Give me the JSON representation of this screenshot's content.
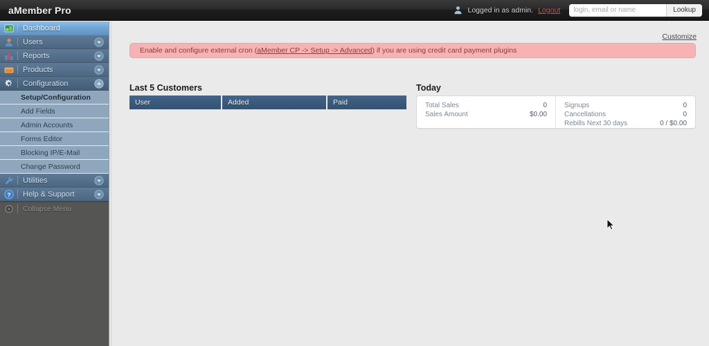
{
  "header": {
    "brand": "aMember Pro",
    "user_icon": "user-icon",
    "login_status": "Logged in as admin.",
    "logout_label": "Logout",
    "lookup_placeholder": "login, email or name",
    "lookup_value": "",
    "lookup_button": "Lookup"
  },
  "sidebar": {
    "items": [
      {
        "label": "Dashboard",
        "icon": "dashboard-icon",
        "state": "active",
        "chevron": "none"
      },
      {
        "label": "Users",
        "icon": "users-icon",
        "state": "normal",
        "chevron": "down"
      },
      {
        "label": "Reports",
        "icon": "reports-icon",
        "state": "normal",
        "chevron": "down"
      },
      {
        "label": "Products",
        "icon": "products-icon",
        "state": "normal",
        "chevron": "down"
      },
      {
        "label": "Configuration",
        "icon": "gear-icon",
        "state": "expanded",
        "chevron": "up"
      }
    ],
    "submenu": [
      {
        "label": "Setup/Configuration",
        "current": true
      },
      {
        "label": "Add Fields",
        "current": false
      },
      {
        "label": "Admin Accounts",
        "current": false
      },
      {
        "label": "Forms Editor",
        "current": false
      },
      {
        "label": "Blocking IP/E-Mail",
        "current": false
      },
      {
        "label": "Change Password",
        "current": false
      }
    ],
    "items_bottom": [
      {
        "label": "Utilities",
        "icon": "wrench-icon",
        "state": "normal",
        "chevron": "down"
      },
      {
        "label": "Help & Support",
        "icon": "help-icon",
        "state": "normal",
        "chevron": "down"
      }
    ],
    "collapse": {
      "label": "Collapse Menu",
      "icon": "collapse-icon"
    }
  },
  "content": {
    "customize_label": "Customize",
    "alert": {
      "text_before": "Enable and configure external cron (",
      "link": "aMember CP -> Setup -> Advanced",
      "text_after": ") if you are using credit card payment plugins"
    },
    "last_customers": {
      "heading": "Last 5 Customers",
      "columns": [
        "User",
        "Added",
        "Paid"
      ],
      "rows": []
    },
    "today": {
      "heading": "Today",
      "left": [
        {
          "label": "Total Sales",
          "value": "0"
        },
        {
          "label": "Sales Amount",
          "value": "$0.00"
        }
      ],
      "right": [
        {
          "label": "Signups",
          "value": "0"
        },
        {
          "label": "Cancellations",
          "value": "0"
        },
        {
          "label": "Rebills Next 30 days",
          "value": "0 / $0.00"
        }
      ]
    }
  },
  "colors": {
    "header_bg": "#1d1d1d",
    "sidebar_bg": "#555554",
    "nav_blue": "#4d6781",
    "nav_active": "#6fa5d4",
    "submenu_bg": "#8fa7bd",
    "content_bg": "#eaeaea",
    "table_header": "#3a5a7c",
    "alert_bg": "#f7b3b3",
    "alert_text": "#8d3a3a",
    "logout_link": "#d4504e"
  }
}
